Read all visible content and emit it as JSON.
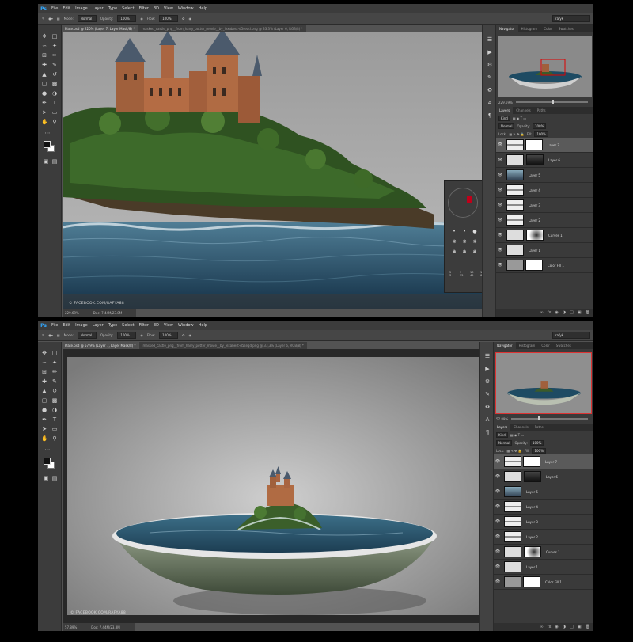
{
  "app": {
    "logo": "Ps",
    "menu": [
      "File",
      "Edit",
      "Image",
      "Layer",
      "Type",
      "Select",
      "Filter",
      "3D",
      "View",
      "Window",
      "Help"
    ]
  },
  "options": {
    "mode_label": "Mode:",
    "mode_value": "Normal",
    "opacity_label": "Opacity:",
    "opacity_value": "100%",
    "flow_label": "Flow:",
    "flow_value": "100%",
    "workspace": "rafyk"
  },
  "top": {
    "tabs": [
      "Plate.psd @ 220% (Layer 7, Layer Mask/8) *",
      "masked_castle_png__from_harry_potter_movie__by_lexabest-d5seqd.png @ 33,3% (Layer 6, RGB/8) *"
    ],
    "status_zoom": "229.69%",
    "status_doc": "Doc: 7.44M/23.8M",
    "nav_zoom": "229.69%",
    "watermark": "© FACEBOOK.COM/RAFYA88",
    "brush": {
      "size_label": "Size:",
      "size_value": "21 px",
      "hardness_label": "Hardness:",
      "numbers": [
        "5",
        "9",
        "13",
        "17",
        "1",
        "30",
        "40",
        "56",
        "3",
        "35",
        "45",
        "65",
        "100",
        "200",
        "300"
      ]
    }
  },
  "bottom": {
    "tabs": [
      "Plate.psd @ 57.9% (Layer 7, Layer Mask/8) *",
      "masked_castle_png__from_harry_potter_movie__by_lexabest-d5seqd.png @ 33,3% (Layer 6, RGB/8) *"
    ],
    "status_zoom": "57.89%",
    "status_doc": "Doc: 7.44M/23.8M",
    "nav_zoom": "57.89%",
    "watermark": "© FACEBOOK.COM/RAFYA88"
  },
  "panels": {
    "nav_tabs": [
      "Navigator",
      "Histogram",
      "Color",
      "Swatches"
    ],
    "layer_tabs": [
      "Layers",
      "Channels",
      "Paths"
    ],
    "kind": "Kind",
    "blend": "Normal",
    "opacity_label": "Opacity:",
    "opacity_value": "100%",
    "lock_label": "Lock:",
    "fill_label": "Fill:",
    "fill_value": "100%"
  },
  "layers": [
    {
      "name": "Layer 7",
      "selected": true
    },
    {
      "name": "Layer 6",
      "selected": false
    },
    {
      "name": "Layer 5",
      "selected": false
    },
    {
      "name": "Layer 4",
      "selected": false
    },
    {
      "name": "Layer 3",
      "selected": false
    },
    {
      "name": "Layer 2",
      "selected": false
    },
    {
      "name": "Curves 1",
      "selected": false
    },
    {
      "name": "Layer 1",
      "selected": false
    },
    {
      "name": "Color Fill 1",
      "selected": false
    }
  ]
}
